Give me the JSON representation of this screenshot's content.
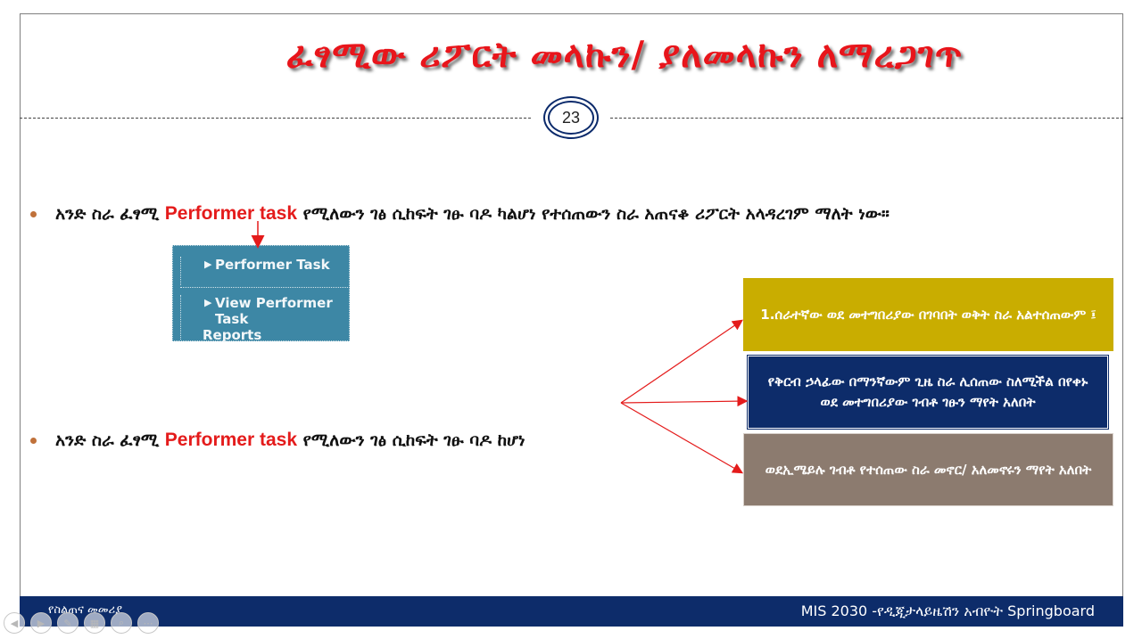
{
  "slide": {
    "title": "ፈፃሚው ሪፖርት መላኩን/ ያለመላኩን ለማረጋገጥ",
    "page_number": "23"
  },
  "bullets": {
    "first": {
      "pre": "አንድ ስራ ፈፃሚ ",
      "highlight": "Performer task",
      "post": " የሚለውን ገፅ ሲከፍት ገፁ ባዶ ካልሆነ የተሰጠውን ስራ አጠናቆ ሪፖርት አላዳረገም ማለት ነው።"
    },
    "second": {
      "pre": "አንድ ስራ ፈፃሚ ",
      "highlight": "Performer task",
      "post": " የሚለውን ገፅ ሲከፍት ገፁ ባዶ ከሆነ"
    }
  },
  "menu_snippet": {
    "item1": "Performer Task",
    "item2_line1": "View Performer Task",
    "item2_line2": "Reports"
  },
  "boxes": {
    "box1": "1.ሰራተኛው ወደ መተግበሪያው በገባበት ወቅት ስራ አልተሰጠውም ፤",
    "box2": "የቅርብ ኃላፊው በማንኛውም ጊዜ ስራ ሊሰጠው ስለሚችል በየቀኑ ወደ መተግበሪያው ገብቶ ገፁን ማየት አለበት",
    "box3": "ወደኢሜይሉ ገብቶ የተሰጠው ስራ መኖር/ አለመኖሩን ማየት አለበት"
  },
  "footer": {
    "left": "የስልጠና መመሪያ",
    "right": "MIS 2030 -የዲጂታላይዜሽን አብዮት Springboard"
  },
  "colors": {
    "title_red": "#e8151b",
    "navy": "#0d2c6a",
    "gold": "#c9ad00",
    "taupe": "#8c7b6f",
    "menu_teal": "#3d87a5",
    "bullet_dot": "#c0713a"
  },
  "icons": {
    "controls": [
      "previous-icon",
      "play-icon",
      "pen-icon",
      "slides-icon",
      "zoom-icon",
      "more-icon"
    ]
  }
}
